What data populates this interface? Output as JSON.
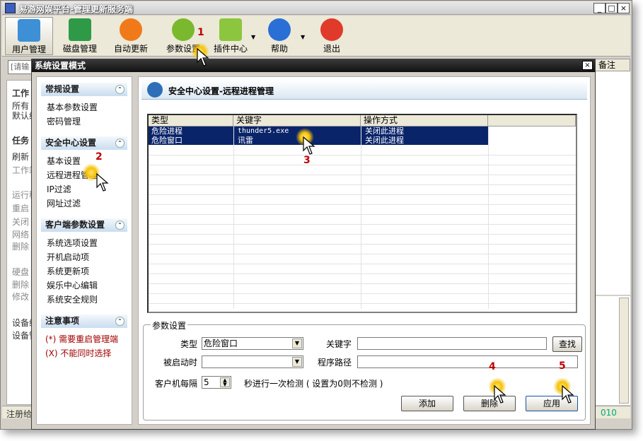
{
  "window": {
    "title": "易游网娱平台-管理更新服务端",
    "min": "_",
    "max": "□",
    "close": "×"
  },
  "toolbar": {
    "items": [
      {
        "label": "用户管理",
        "icon": "user-icon",
        "color": "#3d8fd6"
      },
      {
        "label": "磁盘管理",
        "icon": "disk-icon",
        "color": "#2e9a48"
      },
      {
        "label": "自动更新",
        "icon": "update-icon",
        "color": "#f07a1a"
      },
      {
        "label": "参数设置",
        "icon": "gear-icon",
        "color": "#7ab82e"
      },
      {
        "label": "插件中心",
        "icon": "plugin-icon",
        "color": "#8cc63f"
      },
      {
        "label": "帮助",
        "icon": "help-icon",
        "color": "#2a6fd6"
      },
      {
        "label": "退出",
        "icon": "exit-icon",
        "color": "#e03a2a"
      }
    ]
  },
  "background": {
    "search_placeholder": "[请输",
    "col_remark": "备注",
    "group1_title": "工作",
    "group1_lines": [
      "所有",
      "默认组"
    ],
    "group2_title": "任务",
    "group2_lines": [
      "刷新",
      "工作站"
    ],
    "group3_lines": [
      "运行程",
      "重启",
      "关闭",
      "网络",
      "删除"
    ],
    "group4_lines": [
      "硬盘",
      "删除",
      "修改"
    ],
    "group5_lines": [
      "设备组",
      "设备管"
    ],
    "status_left": "注册给",
    "status_right": "010"
  },
  "dialog": {
    "title": "系统设置模式",
    "close": "×",
    "sections": [
      {
        "title": "常规设置",
        "toggle": "⌃",
        "items": [
          "基本参数设置",
          "密码管理"
        ]
      },
      {
        "title": "安全中心设置",
        "toggle": "⌃",
        "items": [
          "基本设置",
          "远程进程管理",
          "IP过滤",
          "网址过滤"
        ]
      },
      {
        "title": "客户端参数设置",
        "toggle": "⌃",
        "items": [
          "系统选项设置",
          "开机启动项",
          "系统更新项",
          "娱乐中心编辑",
          "系统安全规则"
        ]
      },
      {
        "title": "注意事项",
        "toggle": "⌃",
        "items": [
          "(*) 需要重启管理端",
          "(X) 不能同时选择"
        ]
      }
    ],
    "panel_title": "安全中心设置-远程进程管理",
    "grid": {
      "headers": [
        "类型",
        "关键字",
        "操作方式"
      ],
      "rows": [
        [
          "危险进程",
          "thunder5.exe",
          "关闭此进程"
        ],
        [
          "危险窗口",
          "讯雷",
          "关闭此进程"
        ]
      ]
    },
    "params": {
      "legend": "参数设置",
      "type_label": "类型",
      "type_value": "危险窗口",
      "keyword_label": "关键字",
      "keyword_value": "",
      "find_button": "查找",
      "started_label": "被启动时",
      "started_value": "",
      "path_label": "程序路径",
      "path_value": "",
      "interval_label": "客户机每隔",
      "interval_value": "5",
      "interval_suffix": "秒进行一次检测 ( 设置为0则不检测 )",
      "add_button": "添加",
      "delete_button": "删除",
      "apply_button": "应用"
    }
  },
  "callouts": [
    "1",
    "2",
    "3",
    "4",
    "5"
  ]
}
